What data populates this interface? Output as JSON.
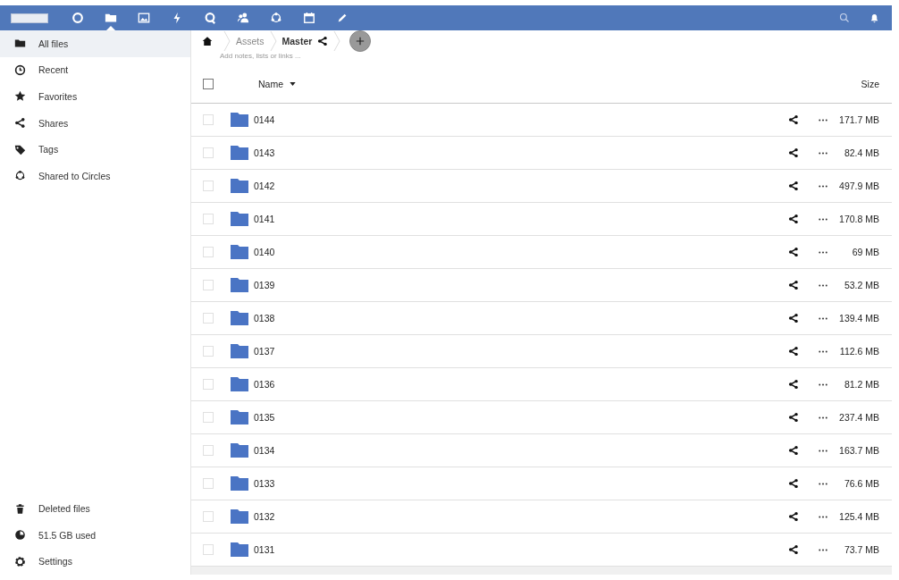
{
  "header": {
    "apps": [
      {
        "kind": "circle",
        "selected": false
      },
      {
        "kind": "folder",
        "selected": true
      },
      {
        "kind": "image",
        "selected": false
      },
      {
        "kind": "bolt",
        "selected": false
      },
      {
        "kind": "talk",
        "selected": false
      },
      {
        "kind": "contacts",
        "selected": false
      },
      {
        "kind": "circles",
        "selected": false
      },
      {
        "kind": "calendar",
        "selected": false
      },
      {
        "kind": "pencil",
        "selected": false
      }
    ]
  },
  "sidebar": {
    "items": [
      {
        "kind": "folder",
        "label": "All files",
        "selected": true
      },
      {
        "kind": "clock",
        "label": "Recent",
        "selected": false
      },
      {
        "kind": "star",
        "label": "Favorites",
        "selected": false
      },
      {
        "kind": "share",
        "label": "Shares",
        "selected": false
      },
      {
        "kind": "tag",
        "label": "Tags",
        "selected": false
      },
      {
        "kind": "circles",
        "label": "Shared to Circles",
        "selected": false
      }
    ],
    "footer": [
      {
        "kind": "trash",
        "label": "Deleted files"
      },
      {
        "kind": "pie",
        "label": "51.5 GB used"
      },
      {
        "kind": "gear",
        "label": "Settings"
      }
    ]
  },
  "breadcrumbs": [
    "Assets",
    "Master"
  ],
  "notes_placeholder": "Add notes, lists or links ...",
  "table": {
    "select_all": {
      "checked": false
    },
    "columns": [
      "Name",
      "Size"
    ],
    "rows": [
      {
        "name": "0144",
        "size": "171.7 MB",
        "checked": false
      },
      {
        "name": "0143",
        "size": "82.4 MB",
        "checked": false
      },
      {
        "name": "0142",
        "size": "497.9 MB",
        "checked": false
      },
      {
        "name": "0141",
        "size": "170.8 MB",
        "checked": false
      },
      {
        "name": "0140",
        "size": "69 MB",
        "checked": false
      },
      {
        "name": "0139",
        "size": "53.2 MB",
        "checked": false
      },
      {
        "name": "0138",
        "size": "139.4 MB",
        "checked": false
      },
      {
        "name": "0137",
        "size": "112.6 MB",
        "checked": false
      },
      {
        "name": "0136",
        "size": "81.2 MB",
        "checked": false
      },
      {
        "name": "0135",
        "size": "237.4 MB",
        "checked": false
      },
      {
        "name": "0134",
        "size": "163.7 MB",
        "checked": false
      },
      {
        "name": "0133",
        "size": "76.6 MB",
        "checked": false
      },
      {
        "name": "0132",
        "size": "125.4 MB",
        "checked": false
      },
      {
        "name": "0131",
        "size": "73.7 MB",
        "checked": false
      }
    ]
  }
}
